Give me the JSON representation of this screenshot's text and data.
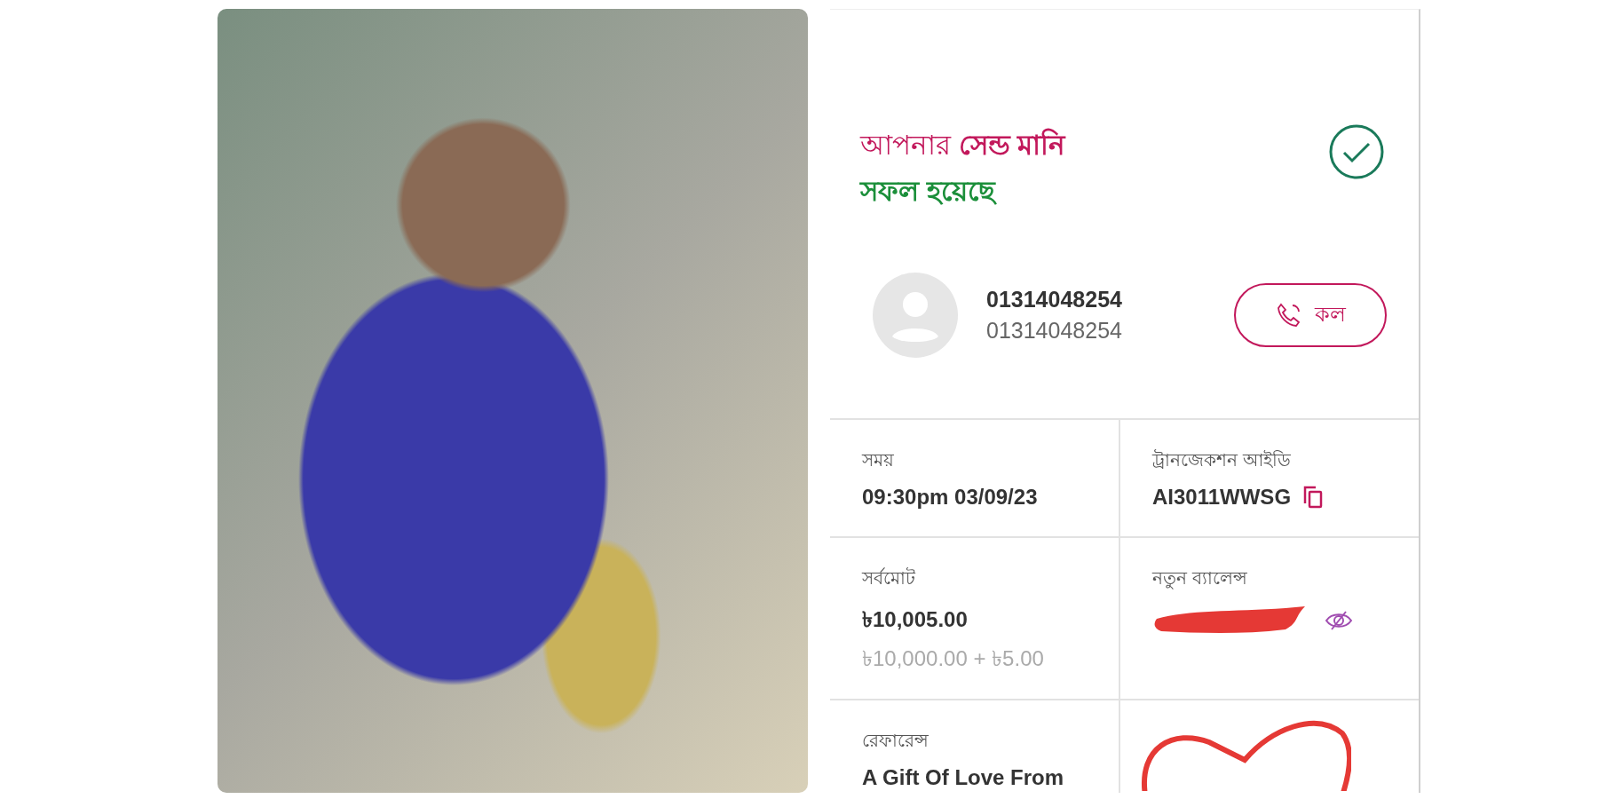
{
  "status": {
    "title": "আপনার **সেন্ড মানি**",
    "subtitle": "সফল হয়েছে"
  },
  "recipient": {
    "name": "01314048254",
    "number": "01314048254",
    "call_button": "কল"
  },
  "details": [
    {
      "kind": "text",
      "label": "সময়",
      "value": "09:30pm 03/09/23"
    },
    {
      "kind": "copy",
      "label": "ট্রানজেকশন আইডি",
      "value": "AI3011WWSG"
    },
    {
      "kind": "text",
      "label": "সর্বমোট",
      "value": "৳10,005.00",
      "note": "৳10,000.00 + ৳5.00"
    },
    {
      "kind": "hidden",
      "label": "নতুন ব্যালেন্স"
    },
    {
      "kind": "text",
      "label": "রেফারেন্স",
      "value": "A Gift Of Love From"
    },
    {
      "kind": "heart"
    }
  ]
}
